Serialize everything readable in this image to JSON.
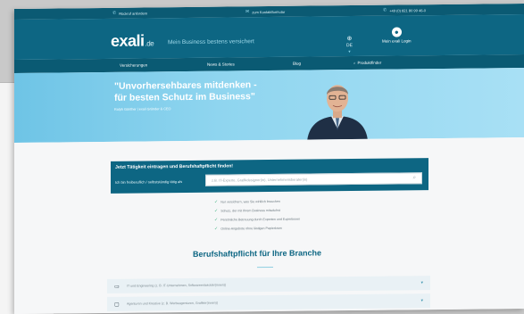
{
  "topbar": {
    "items": [
      {
        "icon": "phone-icon",
        "label": "Rückruf anfordern"
      },
      {
        "icon": "mail-icon",
        "label": "zum Kontaktformular"
      },
      {
        "icon": "phone-icon",
        "label": "+49 (0) 821 80 99 46-0"
      }
    ]
  },
  "header": {
    "logo": "exali",
    "logo_tld": ".de",
    "tagline": "Mein Business bestens versichert",
    "language": "DE",
    "login_label": "Mein exali Login"
  },
  "nav": {
    "items": [
      "Versicherungen",
      "News & Stories",
      "Blog",
      "Produktfinder"
    ]
  },
  "hero": {
    "quote_line1": "\"Unvorhersehbares mitdenken -",
    "quote_line2": "für besten Schutz im Business\"",
    "author": "Ralph Günther | exali Gründer & CEO"
  },
  "finder": {
    "title": "Jetzt Tätigkeit eintragen und Berufshaftpflicht finden!",
    "label": "Ich bin freiberuflich / selbstständig tätig als",
    "placeholder": "z.B. IT-Experte, Grafikdesigner(in), Unternehmensberater(in)"
  },
  "benefits": [
    "Nur versichern, was Sie wirklich brauchen",
    "Schutz, der mit Ihrem Business mitwächst",
    "Persönliche Betreuung durch Experten und Expertinnen",
    "Online-Angebote ohne lästigen Papierkram"
  ],
  "branches": {
    "title": "Berufshaftpflicht für Ihre Branche",
    "rows": [
      {
        "icon": "laptop-icon",
        "label": "IT und Engineering (z. B. IT-Unternehmen, Softwareentwickler(innen))"
      },
      {
        "icon": "monitor-icon",
        "label": "Agenturen und Kreative (z. B. Werbeagenturen, Grafiker(innen))"
      }
    ]
  },
  "colors": {
    "primary": "#0d6683",
    "topbar": "#0b5a73",
    "hero_sky": "#8fd5ef",
    "check": "#4bb98a"
  }
}
